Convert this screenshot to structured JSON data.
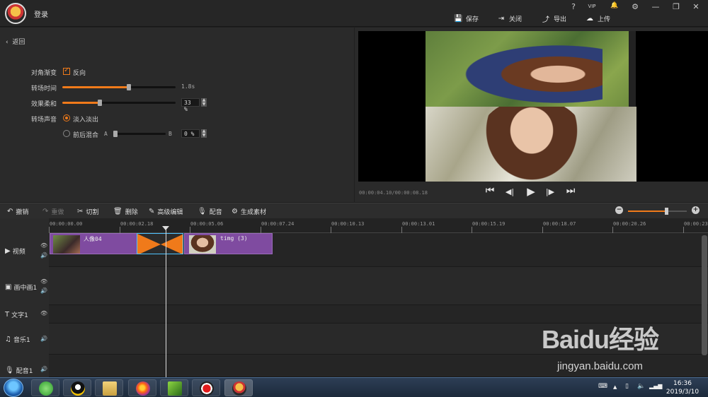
{
  "header": {
    "login": "登录",
    "window_controls": [
      "?",
      "VIP",
      "🔔",
      "⚙",
      "—",
      "❐",
      "✕"
    ],
    "actions": [
      {
        "icon": "save-icon",
        "glyph": "💾",
        "label": "保存"
      },
      {
        "icon": "close-icon",
        "glyph": "⇥",
        "label": "关闭"
      },
      {
        "icon": "export-icon",
        "glyph": "⤴",
        "label": "导出"
      },
      {
        "icon": "upload-icon",
        "glyph": "☁",
        "label": "上传"
      }
    ]
  },
  "settings": {
    "back": "返回",
    "diagonal_label": "对角渐变",
    "reverse_label": "反向",
    "reverse_checked": true,
    "duration_label": "转场时间",
    "duration_value": "1.8s",
    "duration_level": 0.59,
    "softness_label": "效果柔和",
    "softness_value": "33 %",
    "softness_level": 0.33,
    "audio_label": "转场声音",
    "fade_label": "淡入淡出",
    "mix_label": "前后混合",
    "mix_a": "A",
    "mix_b": "B",
    "mix_value": "0 %",
    "mix_level": 0.0
  },
  "preview": {
    "timecode": "00:00:04.10/00:00:08.18",
    "controls": [
      {
        "name": "skip-start-icon",
        "glyph": "⏮"
      },
      {
        "name": "step-back-icon",
        "glyph": "◀|"
      },
      {
        "name": "play-icon",
        "glyph": "▶"
      },
      {
        "name": "step-forward-icon",
        "glyph": "|▶"
      },
      {
        "name": "skip-end-icon",
        "glyph": "⏭"
      }
    ]
  },
  "toolbar": {
    "undo": "撤销",
    "redo": "重做",
    "cut": "切割",
    "delete": "删除",
    "advanced_edit": "高级编辑",
    "dub": "配音",
    "generate": "生成素材",
    "zoom_level": 0.66
  },
  "ruler": {
    "ticks": [
      "00:00:00.00",
      "00:00:02.18",
      "00:00:05.06",
      "00:00:07.24",
      "00:00:10.13",
      "00:00:13.01",
      "00:00:15.19",
      "00:00:18.07",
      "00:00:20.26",
      "00:00:23."
    ]
  },
  "tracks": {
    "video": "视频",
    "pip": "画中画1",
    "text": "文字1",
    "music": "音乐1",
    "voice": "配音1",
    "clip1_label": "人像04",
    "clip2_label": "timg (3)"
  },
  "taskbar": {
    "time": "16:36",
    "date": "2019/3/10"
  },
  "watermark": {
    "brand": "Baidu经验",
    "url": "jingyan.baidu.com"
  }
}
